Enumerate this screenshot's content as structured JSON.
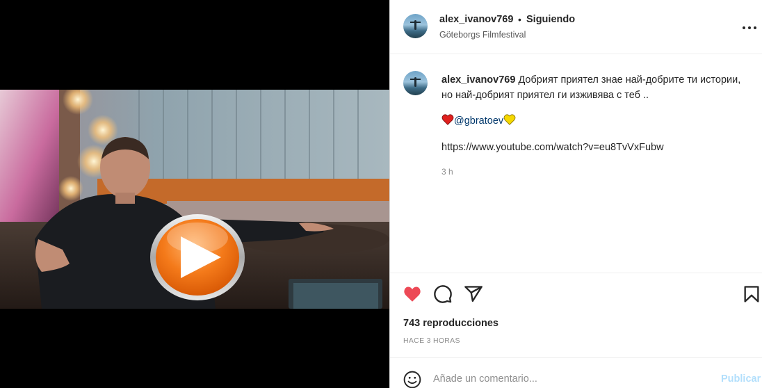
{
  "post": {
    "username": "alex_ivanov769",
    "separator": "•",
    "follow_status": "Siguiendo",
    "location": "Göteborgs Filmfestival"
  },
  "caption": {
    "username": "alex_ivanov769",
    "text": "Добрият приятел знае най-добрите ти истории, но най-добрият приятел ги изживява с теб ..",
    "mention": "@gbratoev",
    "link": "https://www.youtube.com/watch?v=eu8TvVxFubw",
    "time": "3 h"
  },
  "stats": {
    "views": "743 reproducciones",
    "posted": "HACE 3 HORAS"
  },
  "comment": {
    "placeholder": "Añade un comentario...",
    "publish_label": "Publicar"
  },
  "icons": {
    "like": "heart-icon",
    "comment": "comment-icon",
    "share": "paper-plane-icon",
    "save": "bookmark-icon",
    "more": "more-icon",
    "emoji": "smiley-icon",
    "play": "play-icon"
  },
  "colors": {
    "like": "#ed4956",
    "link": "#00376b",
    "publish_disabled": "#b2dffc",
    "play_orange": "#f47a1a"
  }
}
